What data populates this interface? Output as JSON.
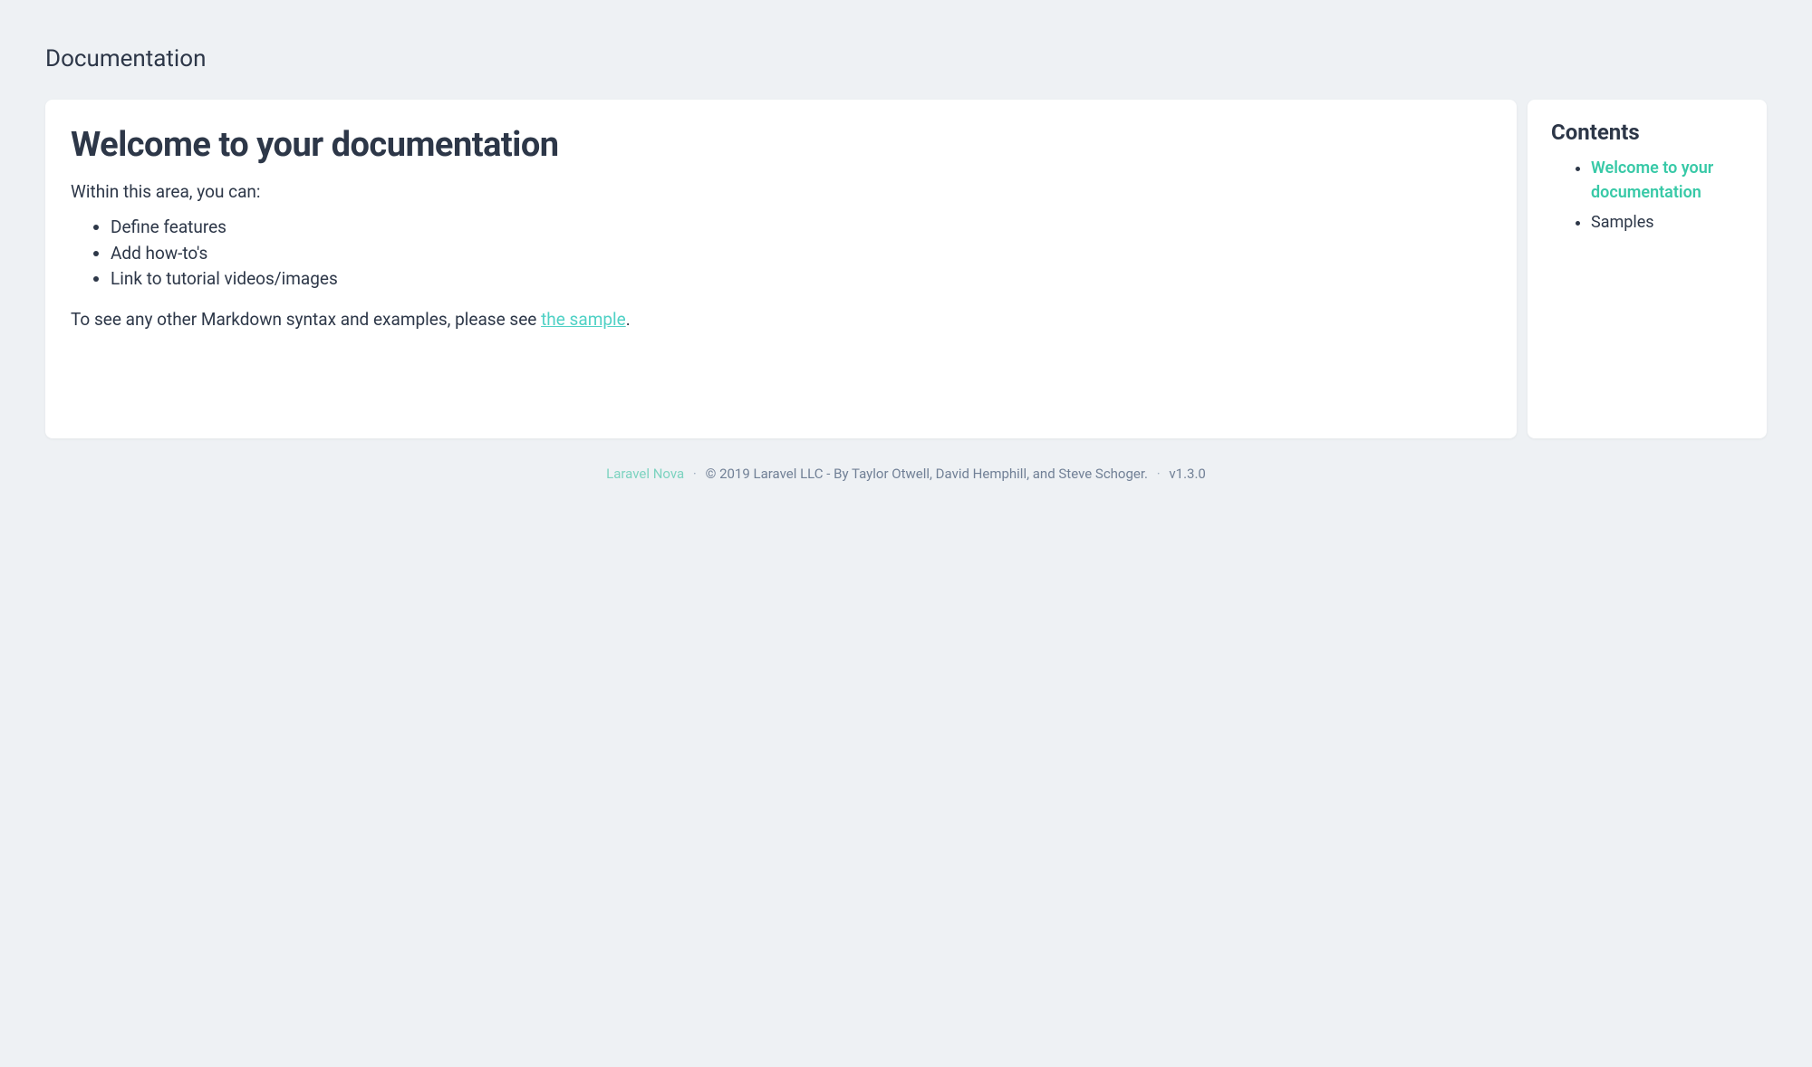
{
  "page": {
    "title": "Documentation"
  },
  "main": {
    "heading": "Welcome to your documentation",
    "intro": "Within this area, you can:",
    "bullets": [
      "Define features",
      "Add how-to's",
      "Link to tutorial videos/images"
    ],
    "outro_prefix": "To see any other Markdown syntax and examples, please see ",
    "outro_link_text": "the sample",
    "outro_suffix": "."
  },
  "sidebar": {
    "heading": "Contents",
    "items": [
      {
        "label": "Welcome to your documentation",
        "active": true
      },
      {
        "label": "Samples",
        "active": false
      }
    ]
  },
  "footer": {
    "link_text": "Laravel Nova",
    "copyright": "© 2019 Laravel LLC - By Taylor Otwell, David Hemphill, and Steve Schoger.",
    "version": "v1.3.0",
    "separator": "·"
  }
}
